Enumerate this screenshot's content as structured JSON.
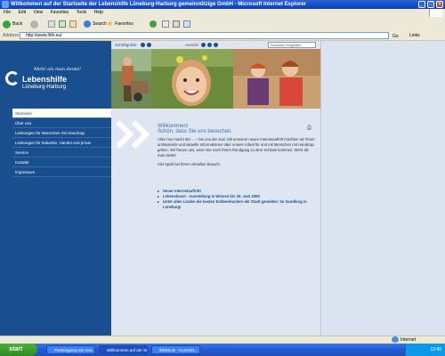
{
  "window": {
    "title": "Willkommen auf der Startseite der   Lebenshilfe Lüneburg-Harburg gemeinnützige GmbH - Microsoft Internet Explorer"
  },
  "menu": [
    "File",
    "Edit",
    "View",
    "Favorites",
    "Tools",
    "Help"
  ],
  "toolbar": {
    "back": "Back",
    "search": "Search",
    "favorites": "Favorites"
  },
  "addressbar": {
    "label": "Address",
    "url": "http://www.lhlh.eu/",
    "go": "Go",
    "links": "Links"
  },
  "site": {
    "tagline": "Mehr als man denkt!",
    "brand": "Lebenshilfe",
    "region": "Lüneburg-Harburg",
    "topbar": {
      "font_size": "Schriftgröße",
      "view": "Ansicht",
      "search_placeholder": "Suchwort eingeben"
    },
    "nav": [
      "Startseite",
      "Über uns",
      "Leistungen für Menschen mit Handicap",
      "Leistungen für Industrie, Handel und privat",
      "Service",
      "Kontakt",
      "Impressum"
    ],
    "welcome": {
      "heading1": "Willkommen!",
      "heading2": "Schön, dass Sie uns besuchen.",
      "body": "Alles neu macht der ... – bei uns der Juni. Mit unserem neuen Internetauftritt möchten wir Ihnen umfassende und aktuelle Informationen über unsere Arbeit für und mit Menschen mit Handicap geben. Wir freuen uns, wenn Sie nach Ihrem Rundgang zu dem Schluss kommen: Mehr als man denkt!",
      "closing": "Viel Spaß bei Ihrem virtuellen Besuch."
    },
    "news": [
      "Neuer Internetauftritt!",
      "Lebenskunst - Ausstellung in Winsen bis 30. Juni 2008",
      "Unter allen Linden die besten Erdbeerkuchen der Stadt genießen: Im Sandkrug in Lüneburg!"
    ]
  },
  "statusbar": {
    "zone": "Internet"
  },
  "taskbar": {
    "start": "start",
    "tasks": [
      "Posteingang von mei...",
      "Willkommen auf der St...",
      "lhlh09.de - Kurzmitt..."
    ],
    "clock": "12:40"
  },
  "colors": {
    "brand_blue": "#1a4f8f",
    "page_bg": "#dfe6f2",
    "title_blue": "#0a3fb8"
  }
}
